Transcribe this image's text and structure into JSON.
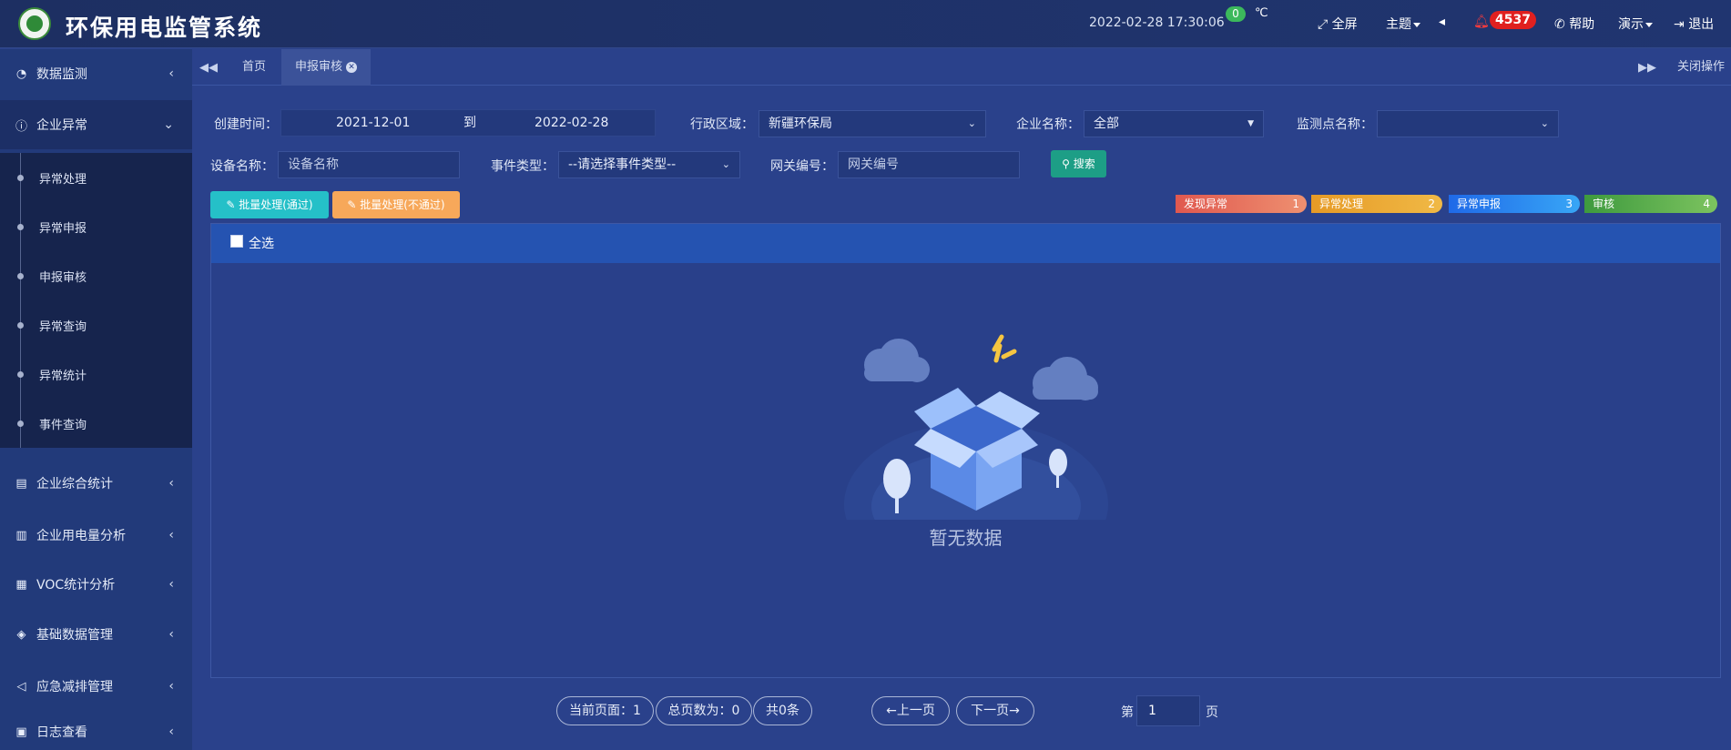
{
  "header": {
    "title": "环保用电监管系统",
    "datetime": "2022-02-28  17:30:06",
    "temperature": "0",
    "temp_unit": "℃",
    "fullscreen_label": "全屏",
    "theme_label": "主题",
    "notification_count": "4537",
    "help_label": "帮助",
    "demo_label": "演示",
    "logout_label": "退出"
  },
  "sidebar": {
    "items": [
      {
        "label": "数据监测",
        "icon": "dashboard-icon"
      },
      {
        "label": "企业异常",
        "icon": "alert-circle-icon"
      },
      {
        "label": "企业综合统计",
        "icon": "presentation-icon"
      },
      {
        "label": "企业用电量分析",
        "icon": "bar-chart-icon"
      },
      {
        "label": "VOC统计分析",
        "icon": "calendar-icon"
      },
      {
        "label": "基础数据管理",
        "icon": "layers-icon"
      },
      {
        "label": "应急减排管理",
        "icon": "megaphone-icon"
      },
      {
        "label": "日志查看",
        "icon": "log-icon"
      }
    ],
    "subitems": [
      "异常处理",
      "异常申报",
      "申报审核",
      "异常查询",
      "异常统计",
      "事件查询"
    ]
  },
  "tabs": {
    "items": [
      "首页",
      "申报审核"
    ],
    "close_all_label": "关闭操作"
  },
  "filters": {
    "created_label": "创建时间：",
    "date_from": "2021-12-01",
    "to_label": "到",
    "date_to": "2022-02-28",
    "region_label": "行政区域：",
    "region_value": "新疆环保局",
    "company_label": "企业名称：",
    "company_value": "全部",
    "monitor_label": "监测点名称：",
    "monitor_value": "",
    "device_label": "设备名称：",
    "device_placeholder": "设备名称",
    "event_label": "事件类型：",
    "event_value": "--请选择事件类型--",
    "gateway_label": "网关编号：",
    "gateway_placeholder": "网关编号",
    "search_label": "搜索"
  },
  "actions": {
    "batch_pass": "批量处理(通过)",
    "batch_reject": "批量处理(不通过)"
  },
  "steps": [
    {
      "label": "发现异常",
      "num": "1",
      "color": "#e8745a"
    },
    {
      "label": "异常处理",
      "num": "2",
      "color": "#e7a52b"
    },
    {
      "label": "异常申报",
      "num": "3",
      "color": "#2a8df0"
    },
    {
      "label": "审核",
      "num": "4",
      "color": "#62b14e"
    }
  ],
  "table": {
    "select_all": "全选",
    "empty_text": "暂无数据"
  },
  "pagination": {
    "current_page": "当前页面：1",
    "total_pages": "总页数为：0",
    "total_count": "共0条",
    "prev": "←上一页",
    "next": "下一页→",
    "page_prefix": "第",
    "page_value": "1",
    "page_suffix": "页"
  }
}
